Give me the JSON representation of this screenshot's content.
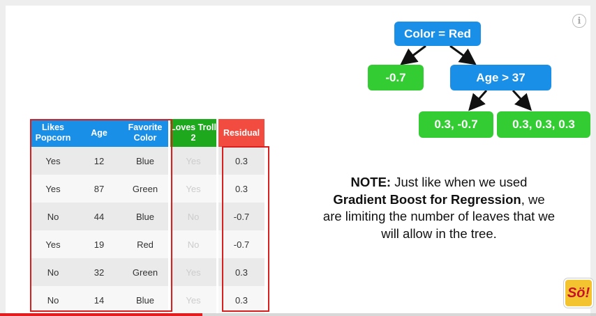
{
  "table": {
    "headers": [
      {
        "label": "Likes Popcorn",
        "color": "#1a8fe8"
      },
      {
        "label": "Age",
        "color": "#1a8fe8"
      },
      {
        "label": "Favorite Color",
        "color": "#1a8fe8"
      },
      {
        "label": "Loves Troll 2",
        "color": "#1ea81e"
      },
      {
        "label": "Residual",
        "color": "#f24b3f"
      }
    ],
    "rows": [
      [
        "Yes",
        "12",
        "Blue",
        "Yes",
        "0.3"
      ],
      [
        "Yes",
        "87",
        "Green",
        "Yes",
        "0.3"
      ],
      [
        "No",
        "44",
        "Blue",
        "No",
        "-0.7"
      ],
      [
        "Yes",
        "19",
        "Red",
        "No",
        "-0.7"
      ],
      [
        "No",
        "32",
        "Green",
        "Yes",
        "0.3"
      ],
      [
        "No",
        "14",
        "Blue",
        "Yes",
        "0.3"
      ]
    ]
  },
  "tree": {
    "root": "Color = Red",
    "left_leaf": "-0.7",
    "inner": "Age > 37",
    "leaf_a": "0.3, -0.7",
    "leaf_b": "0.3, 0.3, 0.3"
  },
  "note": {
    "prefix": "NOTE:",
    "text1": " Just like when we used",
    "bold": "Gradient Boost for Regression",
    "text2": ", we are limiting the number of leaves that we will allow in the tree."
  },
  "player": {
    "info_icon": "info-icon",
    "logo": "Sö!",
    "progress": 0.34,
    "progress_color": "#e31e1e"
  }
}
